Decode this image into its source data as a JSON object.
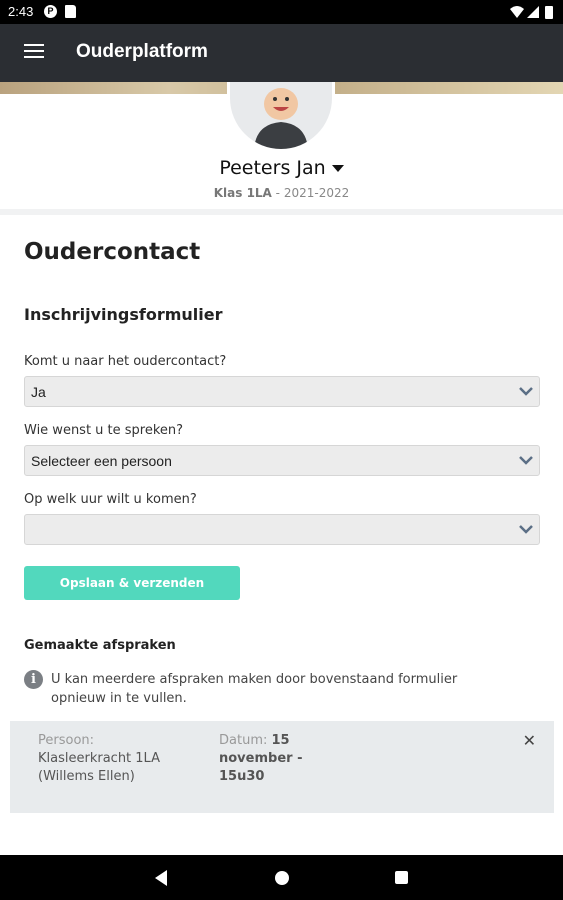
{
  "status_bar": {
    "time": "2:43",
    "p_icon_letter": "P"
  },
  "app_bar": {
    "title": "Ouderplatform",
    "menu_icon": "hamburger-menu-icon"
  },
  "profile": {
    "name": "Peeters Jan",
    "class_label": "Klas 1LA",
    "separator": " - ",
    "year": "2021-2022"
  },
  "page": {
    "title": "Oudercontact",
    "form_title": "Inschrijvingsformulier",
    "fields": [
      {
        "label": "Komt u naar het oudercontact?",
        "value": "Ja"
      },
      {
        "label": "Wie wenst u te spreken?",
        "value": "Selecteer een persoon"
      },
      {
        "label": "Op welk uur wilt u komen?",
        "value": ""
      }
    ],
    "save_label": "Opslaan & verzenden"
  },
  "appointments": {
    "title": "Gemaakte afspraken",
    "info_icon": "info-icon",
    "info_text": "U kan meerdere afspraken maken door bovenstaand formulier opnieuw in te vullen.",
    "items": [
      {
        "person_label": "Persoon:",
        "person_value": "Klasleerkracht 1LA (Willems Ellen)",
        "date_label": "Datum:",
        "date_value_bold": "15",
        "date_value_rest": "november - 15u30",
        "close_symbol": "✕"
      }
    ]
  },
  "colors": {
    "app_bar": "#2b2e33",
    "accent_button": "#52d8bd",
    "card_bg": "#e8ebed",
    "chevron": "#5b6f86"
  }
}
